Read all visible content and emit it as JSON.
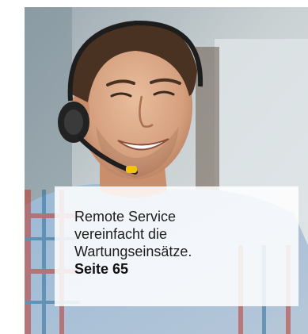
{
  "photo": {
    "subject": "Man wearing a headset"
  },
  "caption": {
    "text": "Remote Service\nvereinfacht die\nWartungseinsätze.",
    "page_ref": "Seite 65"
  }
}
